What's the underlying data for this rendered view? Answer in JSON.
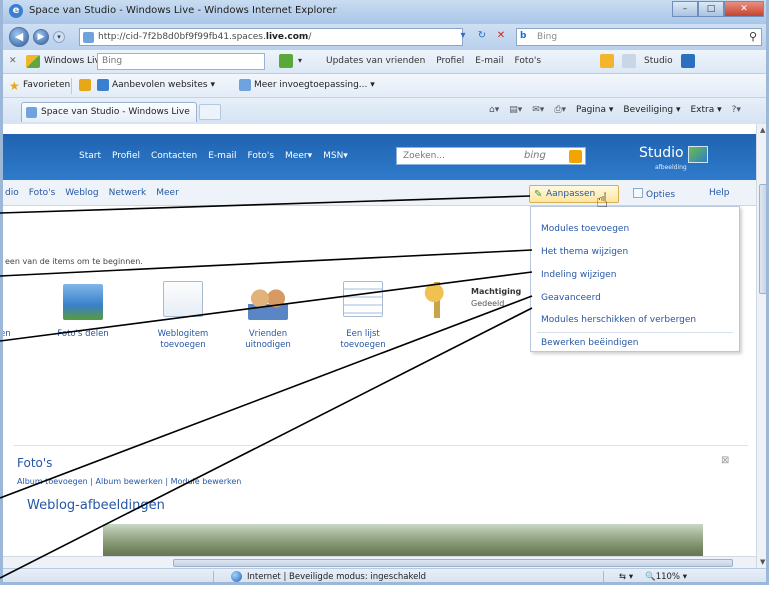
{
  "window": {
    "title": "Space van Studio - Windows Live - Windows Internet Explorer",
    "min": "–",
    "max": "□",
    "close": "✕"
  },
  "address": {
    "url_prefix": "http://cid-7f2b8d0bf9f99fb41.spaces.",
    "url_domain": "live.com",
    "url_suffix": "/",
    "search_placeholder": "Bing",
    "search_engine": "b"
  },
  "live_toolbar": {
    "label": "Windows Live",
    "search_value": "Bing",
    "links": [
      "Updates van vrienden",
      "Profiel",
      "E-mail",
      "Foto's"
    ],
    "studio": "Studio"
  },
  "favorites": {
    "label": "Favorieten",
    "items": [
      "Aanbevolen websites ▾",
      "Meer invoegtoepassing... ▾"
    ]
  },
  "tabs": {
    "active": "Space van Studio - Windows Live",
    "commands": [
      "Pagina ▾",
      "Beveiliging ▾",
      "Extra ▾"
    ]
  },
  "space": {
    "nav": [
      "Start",
      "Profiel",
      "Contacten",
      "E-mail",
      "Foto's",
      "Meer▾",
      "MSN▾"
    ],
    "search_placeholder": "Zoeken...",
    "search_brand": "bing",
    "studio": "Studio ▾",
    "studio_sub": "afbeelding"
  },
  "subnav": {
    "links": [
      "dio",
      "Foto's",
      "Weblog",
      "Netwerk",
      "Meer"
    ],
    "aanpassen": "Aanpassen",
    "opties": "Opties",
    "help": "Help"
  },
  "dropdown": {
    "items": [
      "Modules toevoegen",
      "Het thema wijzigen",
      "Indeling wijzigen",
      "Geavanceerd",
      "Modules herschikken of verbergen",
      "Bewerken beëindigen"
    ]
  },
  "intro_text": "een van de items om te beginnen.",
  "tiles": [
    {
      "label": "ken"
    },
    {
      "label": "Foto's delen"
    },
    {
      "label": "Weblogitem toevoegen"
    },
    {
      "label": "Vrienden uitnodigen"
    },
    {
      "label": "Een lijst toevoegen"
    }
  ],
  "machtiging": {
    "title": "Machtiging",
    "sub": "Gedeeld"
  },
  "fotos": {
    "heading": "Foto's",
    "links": "Album toevoegen | Album bewerken | Module bewerken",
    "weblog_heading": "Weblog-afbeeldingen"
  },
  "status": {
    "text": "Internet | Beveiligde modus: ingeschakeld",
    "zoom": "110%"
  },
  "colors": {
    "accent": "#2657a5",
    "header_blue": "#1f63b0",
    "highlight": "#ffe6a0"
  }
}
